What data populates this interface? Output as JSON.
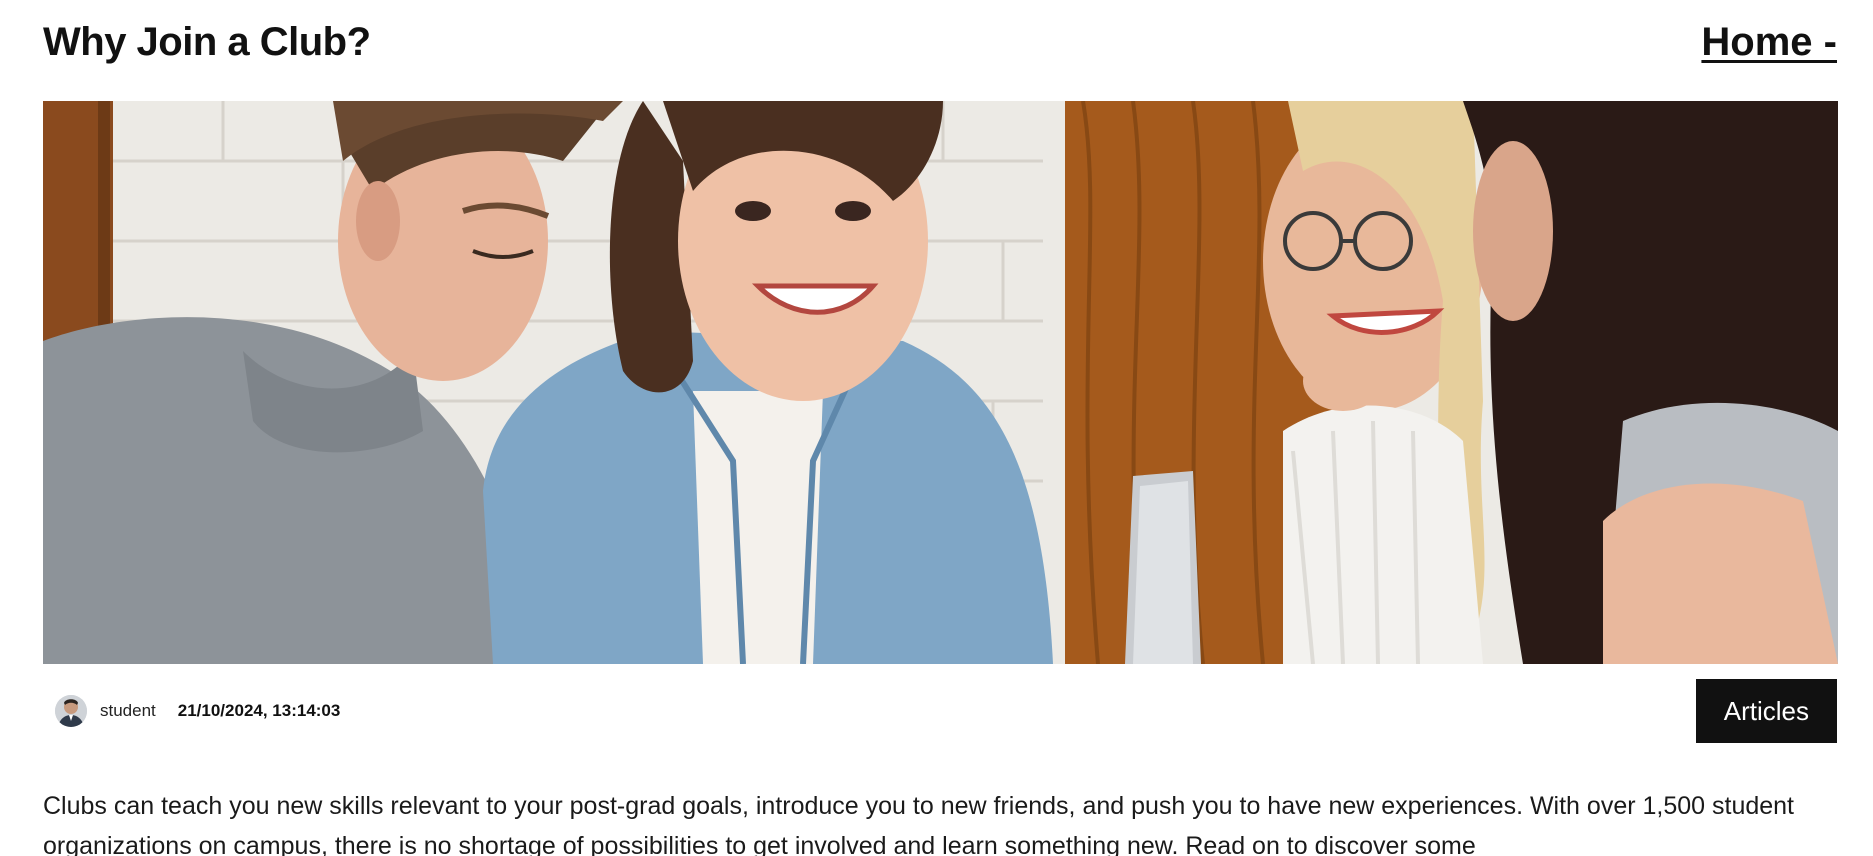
{
  "header": {
    "title": "Why Join a Club?",
    "home_link": "Home -"
  },
  "hero": {
    "image": "students-smiling-around-table-photo"
  },
  "meta": {
    "author": "student",
    "date": "21/10/2024, 13:14:03",
    "category": "Articles"
  },
  "article": {
    "intro": "Clubs can teach you new skills relevant to your post-grad goals, introduce you to new friends, and push you to have new experiences. With over 1,500 student organizations on campus, there is no shortage of possibilities to get involved and learn something new. Read on to discover some"
  }
}
